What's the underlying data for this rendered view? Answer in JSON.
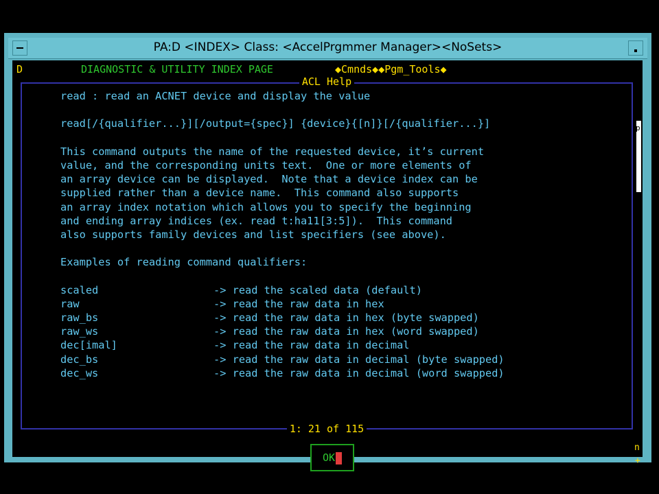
{
  "window": {
    "title": "PA:D <INDEX> Class: <AccelPrgmmer Manager><NoSets>"
  },
  "header": {
    "prefix": "D",
    "title": "DIAGNOSTIC & UTILITY INDEX PAGE",
    "menus": "◆Cmnds◆◆Pgm_Tools◆"
  },
  "dialog": {
    "title": "ACL Help",
    "lines": [
      "read : read an ACNET device and display the value",
      "",
      "read[/{qualifier...}][/output={spec}] {device}{[n]}[/{qualifier...}]",
      "",
      "This command outputs the name of the requested device, it’s current",
      "value, and the corresponding units text.  One or more elements of",
      "an array device can be displayed.  Note that a device index can be",
      "supplied rather than a device name.  This command also supports",
      "an array index notation which allows you to specify the beginning",
      "and ending array indices (ex. read t:ha11[3:5]).  This command",
      "also supports family devices and list specifiers (see above).",
      "",
      "Examples of reading command qualifiers:",
      ""
    ],
    "qualifiers": [
      {
        "name": "scaled",
        "desc": "-> read the scaled data (default)"
      },
      {
        "name": "raw",
        "desc": "-> read the raw data in hex"
      },
      {
        "name": "raw_bs",
        "desc": "-> read the raw data in hex (byte swapped)"
      },
      {
        "name": "raw_ws",
        "desc": "-> read the raw data in hex (word swapped)"
      },
      {
        "name": "dec[imal]",
        "desc": "-> read the raw data in decimal"
      },
      {
        "name": "dec_bs",
        "desc": "-> read the raw data in decimal (byte swapped)"
      },
      {
        "name": "dec_ws",
        "desc": "-> read the raw data in decimal (word swapped)"
      }
    ],
    "ok_label": "OK",
    "status": "1: 21 of 115"
  },
  "scrollbar": {
    "top_glyph": "p",
    "bottom_glyph": "n",
    "plus_glyph": "+"
  },
  "colors": {
    "frame": "#5fb4c4",
    "text": "#62c9f0",
    "yellow": "#ffe000",
    "green": "#2fc82f",
    "border": "#3232a8"
  }
}
